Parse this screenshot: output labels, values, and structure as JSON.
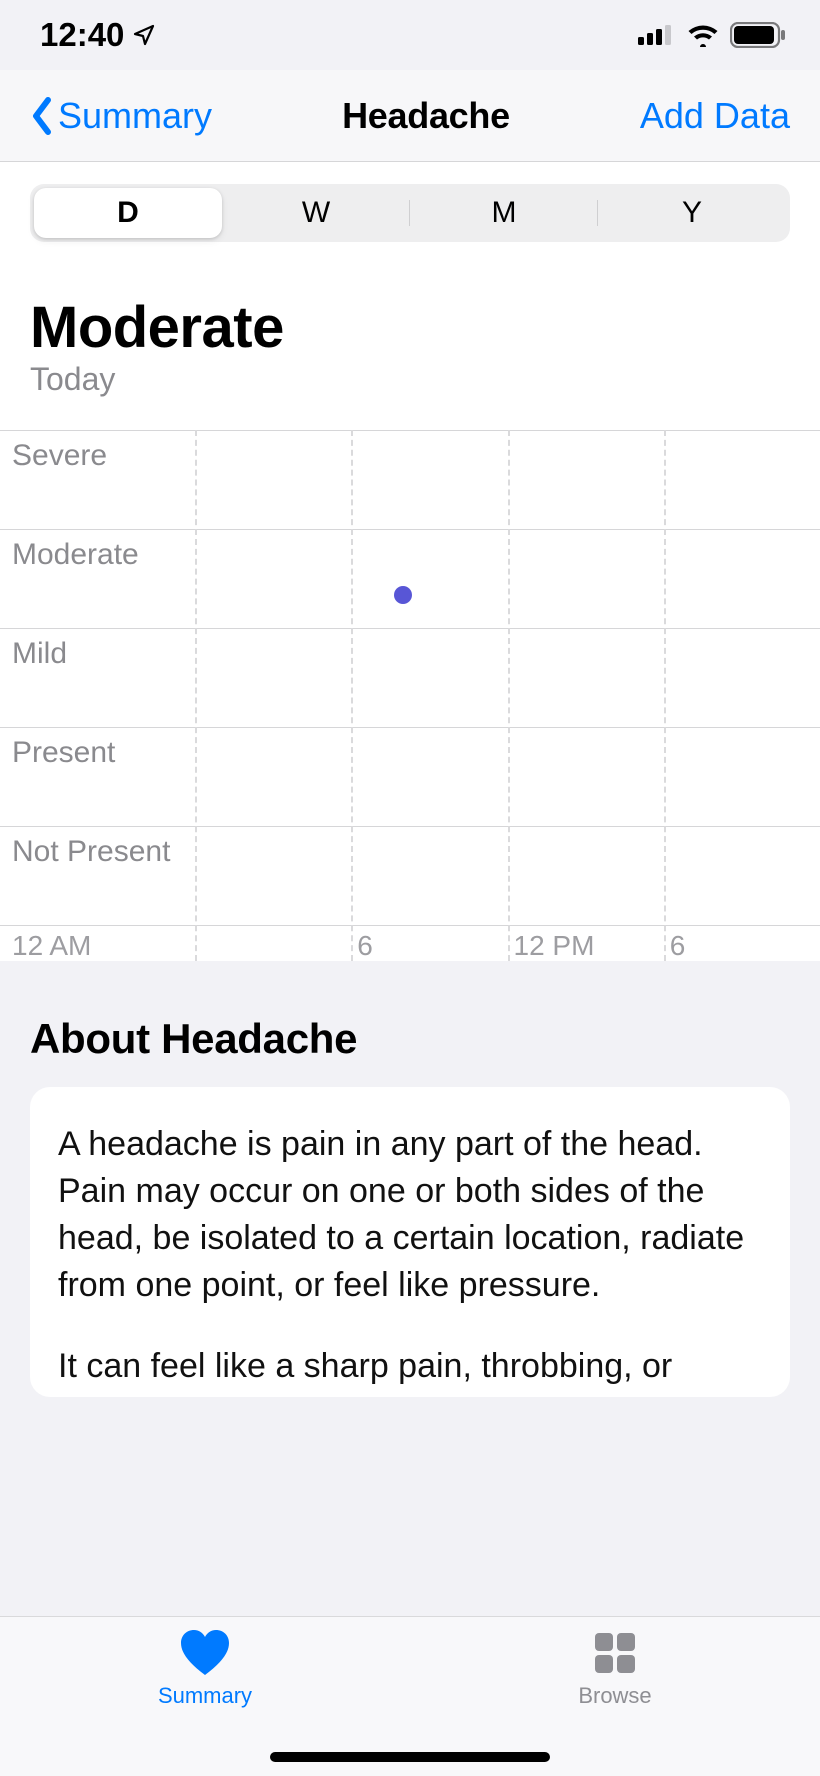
{
  "status_bar": {
    "time": "12:40"
  },
  "nav": {
    "back_label": "Summary",
    "title": "Headache",
    "action_label": "Add Data"
  },
  "segmented": {
    "items": [
      "D",
      "W",
      "M",
      "Y"
    ],
    "selected_index": 0
  },
  "reading": {
    "value": "Moderate",
    "date": "Today"
  },
  "about": {
    "heading": "About Headache",
    "body": "A headache is pain in any part of the head. Pain may occur on one or both sides of the head, be isolated to a certain location, radiate from one point, or feel like pressure.",
    "body2_partial": "It can feel like a sharp pain, throbbing, or"
  },
  "tabs": {
    "summary": "Summary",
    "browse": "Browse"
  },
  "chart_data": {
    "type": "scatter",
    "title": "",
    "y_categories": [
      "Severe",
      "Moderate",
      "Mild",
      "Present",
      "Not Present"
    ],
    "x_ticks": [
      "12 AM",
      "6",
      "12 PM",
      "6"
    ],
    "x_range_hours": [
      0,
      24
    ],
    "points": [
      {
        "hour": 8,
        "y_category": "Moderate"
      }
    ],
    "point_color": "#5856d6"
  }
}
